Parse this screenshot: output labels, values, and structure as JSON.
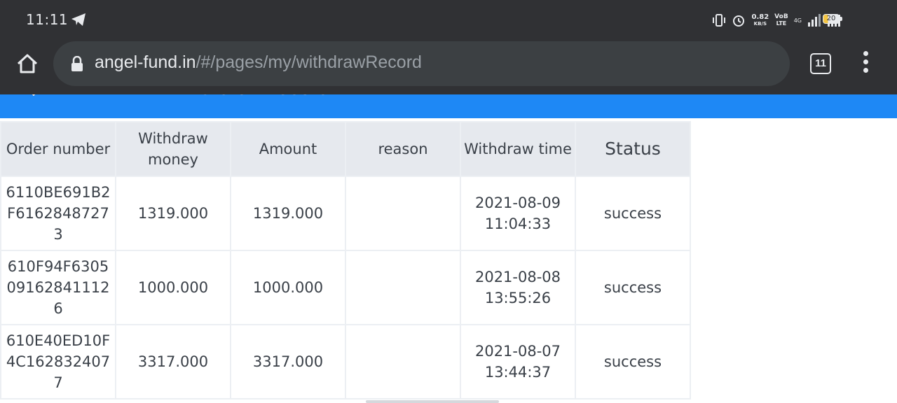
{
  "status_bar": {
    "time": "11:11",
    "net_speed_value": "0.82",
    "net_speed_unit": "KB/S",
    "volte_top": "VoB",
    "volte_bottom": "LTE",
    "network_type": "4G",
    "battery_level": "20",
    "icons": [
      "telegram-icon",
      "vibrate-icon",
      "alarm-icon",
      "signal-icon",
      "battery-icon"
    ]
  },
  "browser": {
    "url_domain": "angel-fund.in",
    "url_path": "/#/pages/my/withdrawRecord",
    "tab_count": "11"
  },
  "page": {
    "title": "Withdraw record",
    "header_color": "#1e88f5"
  },
  "table": {
    "headers": [
      "Order number",
      "Withdraw money",
      "Amount",
      "reason",
      "Withdraw time",
      "Status"
    ],
    "rows": [
      {
        "order": "6110BE691B2F61628487273",
        "money": "1319.000",
        "amount": "1319.000",
        "reason": "",
        "date": "2021-08-09",
        "time": "11:04:33",
        "status": "success"
      },
      {
        "order": "610F94F630509162841112 6",
        "money": "1000.000",
        "amount": "1000.000",
        "reason": "",
        "date": "2021-08-08",
        "time": "13:55:26",
        "status": "success"
      },
      {
        "order": "610E40ED10F4C1628324077",
        "money": "3317.000",
        "amount": "3317.000",
        "reason": "",
        "date": "2021-08-07",
        "time": "13:44:37",
        "status": "success"
      }
    ]
  }
}
